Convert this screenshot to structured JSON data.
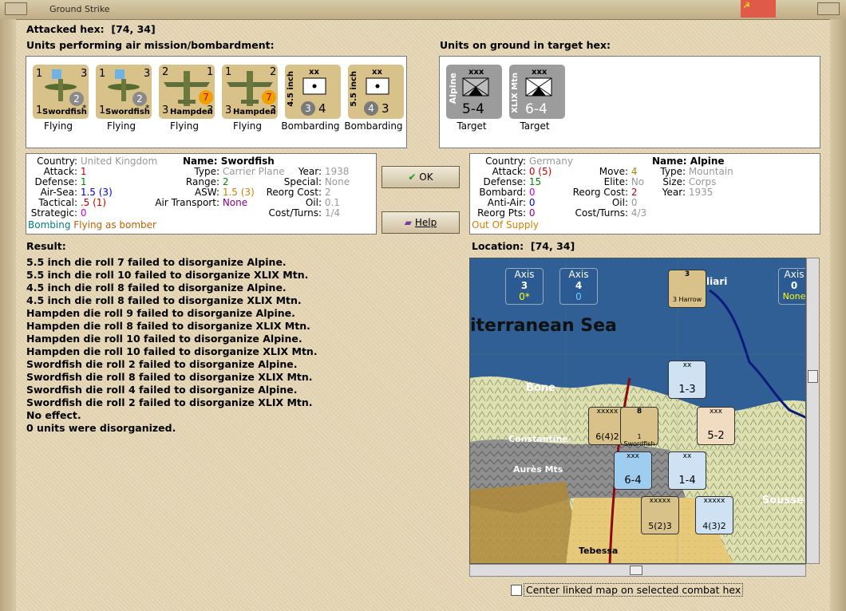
{
  "window": {
    "title": "Ground Strike"
  },
  "attacked_hex": {
    "label": "Attacked hex:",
    "value": "[74, 34]"
  },
  "air_units_label": "Units performing air mission/bombardment:",
  "ground_units_label": "Units on ground in target hex:",
  "air_units": [
    {
      "name": "Swordfish",
      "top_left": "1",
      "top_right": "3",
      "bottom_left": "1",
      "badge": "2",
      "mark": "*",
      "status": "Flying"
    },
    {
      "name": "Swordfish",
      "top_left": "1",
      "top_right": "3",
      "bottom_left": "1",
      "badge": "2",
      "mark": "*",
      "status": "Flying"
    },
    {
      "name": "Hampden",
      "top_left": "2",
      "top_right": "1",
      "bottom_left": "3",
      "bottom_right": "3",
      "badge": "7",
      "status": "Flying"
    },
    {
      "name": "Hampden",
      "top_left": "1",
      "top_right": "2",
      "bottom_left": "3",
      "bottom_right": "3",
      "badge": "7",
      "status": "Flying"
    },
    {
      "name": "4.5 inch",
      "size": "xx",
      "badge": "3",
      "value": "4",
      "status": "Bombarding"
    },
    {
      "name": "5.5 inch",
      "size": "xx",
      "badge": "4",
      "value": "3",
      "status": "Bombarding"
    }
  ],
  "ground_units": [
    {
      "name": "Alpine",
      "size": "xxx",
      "value": "5-4",
      "status": "Target"
    },
    {
      "name": "XLIX Mtn",
      "size": "xxx",
      "value": "6-4",
      "status": "Target"
    }
  ],
  "left_info": {
    "country_label": "Country:",
    "country": "United Kingdom",
    "attack_label": "Attack:",
    "attack": "1",
    "defense_label": "Defense:",
    "defense": "1",
    "airsea_label": "Air-Sea:",
    "airsea": "1.5",
    "airsea_paren": "(3)",
    "tactical_label": "Tactical:",
    "tactical": ".5",
    "tactical_paren": "(1)",
    "strategic_label": "Strategic:",
    "strategic": "0",
    "bombing": "Bombing",
    "flying_as": "Flying as bomber",
    "name_label": "Name:",
    "name": "Swordfish",
    "type_label": "Type:",
    "type": "Carrier Plane",
    "range_label": "Range:",
    "range": "2",
    "asw_label": "ASW:",
    "asw": "1.5",
    "asw_paren": "(3)",
    "airtransport_label": "Air Transport:",
    "airtransport": "None",
    "year_label": "Year:",
    "year": "1938",
    "special_label": "Special:",
    "special": "None",
    "reorg_label": "Reorg Cost:",
    "reorg": "2",
    "oil_label": "Oil:",
    "oil": "0.1",
    "cost_label": "Cost/Turns:",
    "cost": "1/4"
  },
  "right_info": {
    "country_label": "Country:",
    "country": "Germany",
    "attack_label": "Attack:",
    "attack": "0",
    "attack_paren": "(5)",
    "defense_label": "Defense:",
    "defense": "15",
    "bombard_label": "Bombard:",
    "bombard": "0",
    "antiair_label": "Anti-Air:",
    "antiair": "0",
    "reorgpts_label": "Reorg Pts:",
    "reorgpts": "0",
    "supply": "Out Of Supply",
    "move_label": "Move:",
    "move": "4",
    "elite_label": "Elite:",
    "elite": "No",
    "reorg_label": "Reorg Cost:",
    "reorg": "2",
    "oil_label": "Oil:",
    "oil": "0",
    "cost_label": "Cost/Turns:",
    "cost": "4/3",
    "name_label": "Name:",
    "name": "Alpine",
    "type_label": "Type:",
    "type": "Mountain",
    "size_label": "Size:",
    "size": "Corps",
    "year_label": "Year:",
    "year": "1935"
  },
  "buttons": {
    "ok": "OK",
    "help": "Help"
  },
  "result": {
    "label": "Result:",
    "lines": [
      "5.5 inch die roll 7 failed to disorganize Alpine.",
      "5.5 inch die roll 10 failed to disorganize XLIX Mtn.",
      "4.5 inch die roll 8 failed to disorganize Alpine.",
      "4.5 inch die roll 8 failed to disorganize XLIX Mtn.",
      "Hampden die roll 9 failed to disorganize Alpine.",
      "Hampden die roll 8 failed to disorganize XLIX Mtn.",
      "Hampden die roll 10 failed to disorganize Alpine.",
      "Hampden die roll 10 failed to disorganize XLIX Mtn.",
      "Swordfish die roll 2 failed to disorganize Alpine.",
      "Swordfish die roll 8 failed to disorganize XLIX Mtn.",
      "Swordfish die roll 4 failed to disorganize Alpine.",
      "Swordfish die roll 2 failed to disorganize XLIX Mtn.",
      "No effect.",
      "0 units were disorganized."
    ]
  },
  "location": {
    "label": "Location:",
    "value": "[74, 34]"
  },
  "map": {
    "sea": "iterranean Sea",
    "places": [
      "Bone",
      "Constantine",
      "Aurès Mts",
      "Tebessa",
      "Sousse",
      "liari"
    ],
    "axis_boxes": [
      {
        "title": "Axis",
        "value": "3",
        "sub": "0*"
      },
      {
        "title": "Axis",
        "value": "4",
        "sub": "0"
      },
      {
        "title": "Axis",
        "value": "0",
        "sub": "None"
      }
    ],
    "counters": [
      {
        "id": "c1",
        "value": "1-3",
        "top": "xx"
      },
      {
        "id": "c2",
        "value": "6(4)2",
        "top": "xxxxx"
      },
      {
        "id": "c3",
        "value": "1 Swordfish",
        "top": "8"
      },
      {
        "id": "c4",
        "value": "5-2",
        "top": "xxx"
      },
      {
        "id": "c5",
        "value": "6-4",
        "top": "xxx"
      },
      {
        "id": "c6",
        "value": "1-4",
        "top": "xx"
      },
      {
        "id": "c7",
        "value": "5(2)3",
        "top": "xxxxx"
      },
      {
        "id": "c8",
        "value": "4(3)2",
        "top": "xxxxx"
      },
      {
        "id": "c9",
        "value": "3 Harrow",
        "top": "3"
      }
    ]
  },
  "center_map_label": "Center linked map on selected combat hex"
}
